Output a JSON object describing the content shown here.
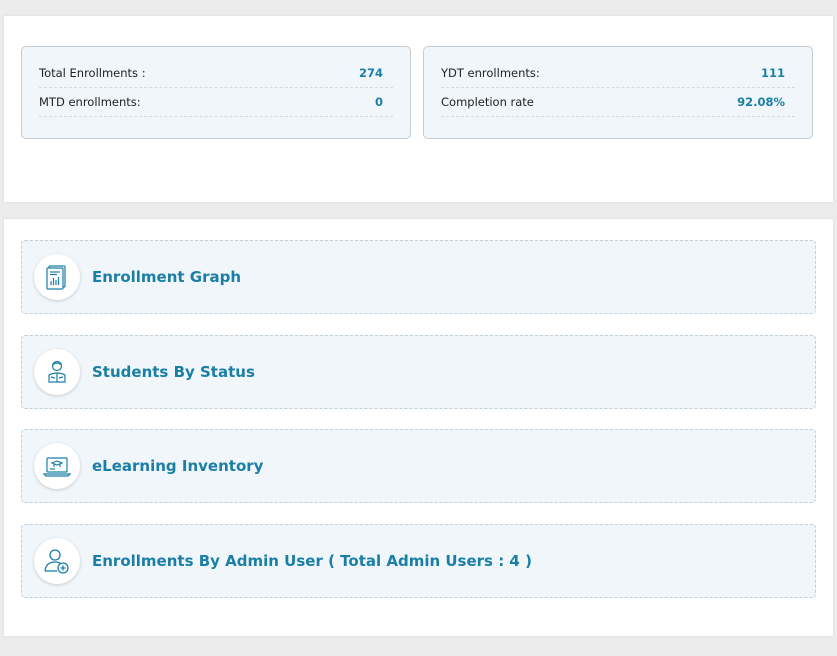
{
  "summary": {
    "left": [
      {
        "label": "Total Enrollments :",
        "value": "274"
      },
      {
        "label": "MTD enrollments:",
        "value": "0"
      }
    ],
    "right": [
      {
        "label": "YDT enrollments:",
        "value": "111"
      },
      {
        "label": "Completion rate",
        "value": "92.08%"
      }
    ]
  },
  "modules": [
    {
      "title": "Enrollment Graph",
      "icon": "report-chart-icon"
    },
    {
      "title": "Students By Status",
      "icon": "student-reading-icon"
    },
    {
      "title": "eLearning Inventory",
      "icon": "elearning-laptop-icon"
    },
    {
      "title": "Enrollments By Admin User ( Total Admin Users : 4 )",
      "icon": "add-user-icon"
    }
  ],
  "colors": {
    "accent": "#1a7fa6",
    "card_bg": "#f1f6fa",
    "page_bg": "#ececec"
  }
}
